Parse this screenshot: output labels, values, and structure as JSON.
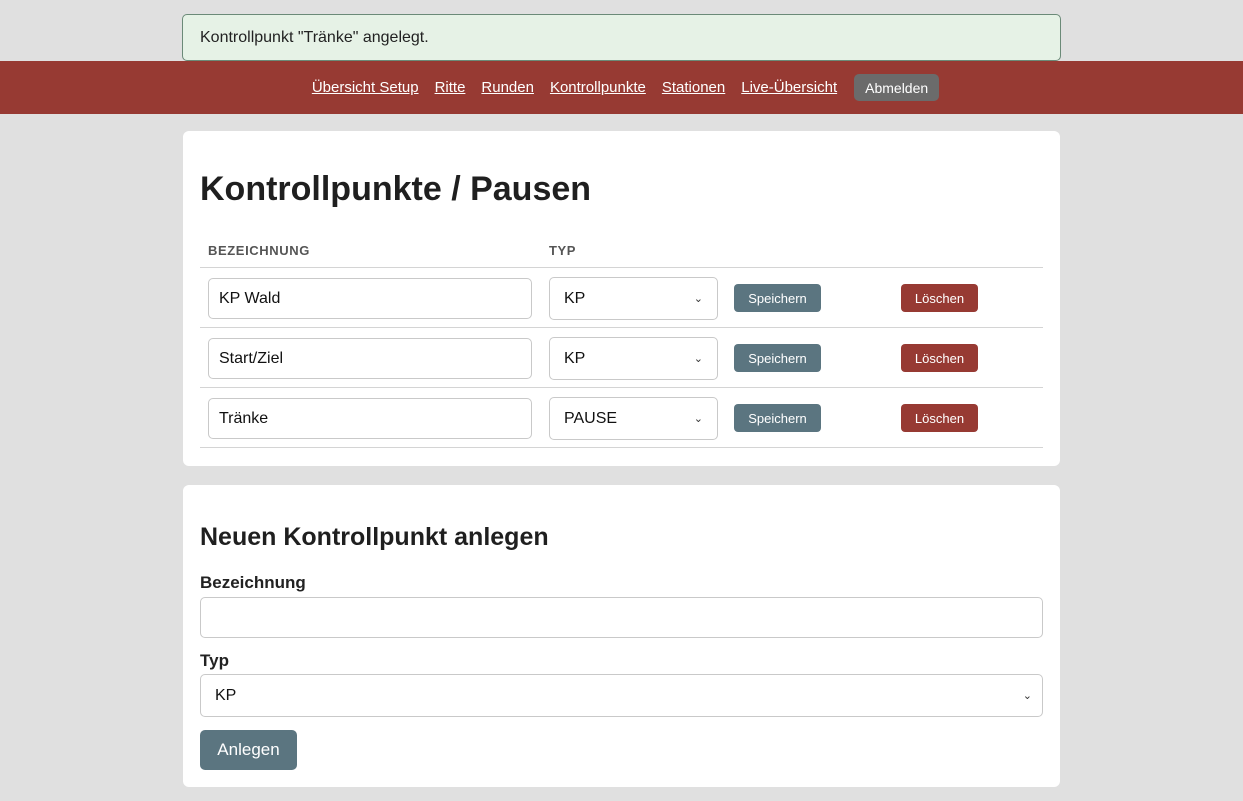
{
  "flash": {
    "message": "Kontrollpunkt \"Tränke\" angelegt."
  },
  "nav": {
    "links": [
      "Übersicht Setup",
      "Ritte",
      "Runden",
      "Kontrollpunkte",
      "Stationen",
      "Live-Übersicht"
    ],
    "logout_label": "Abmelden"
  },
  "list": {
    "title": "Kontrollpunkte / Pausen",
    "columns": {
      "name": "BEZEICHNUNG",
      "type": "TYP"
    },
    "rows": [
      {
        "name": "KP Wald",
        "type": "KP",
        "save": "Speichern",
        "delete": "Löschen"
      },
      {
        "name": "Start/Ziel",
        "type": "KP",
        "save": "Speichern",
        "delete": "Löschen"
      },
      {
        "name": "Tränke",
        "type": "PAUSE",
        "save": "Speichern",
        "delete": "Löschen"
      }
    ]
  },
  "create": {
    "title": "Neuen Kontrollpunkt anlegen",
    "name_label": "Bezeichnung",
    "name_value": "",
    "type_label": "Typ",
    "type_value": "KP",
    "submit_label": "Anlegen"
  },
  "colors": {
    "nav_bg": "#973a33",
    "primary_button": "#5b7580",
    "danger_button": "#973a33",
    "flash_bg": "#e6f2e6"
  }
}
